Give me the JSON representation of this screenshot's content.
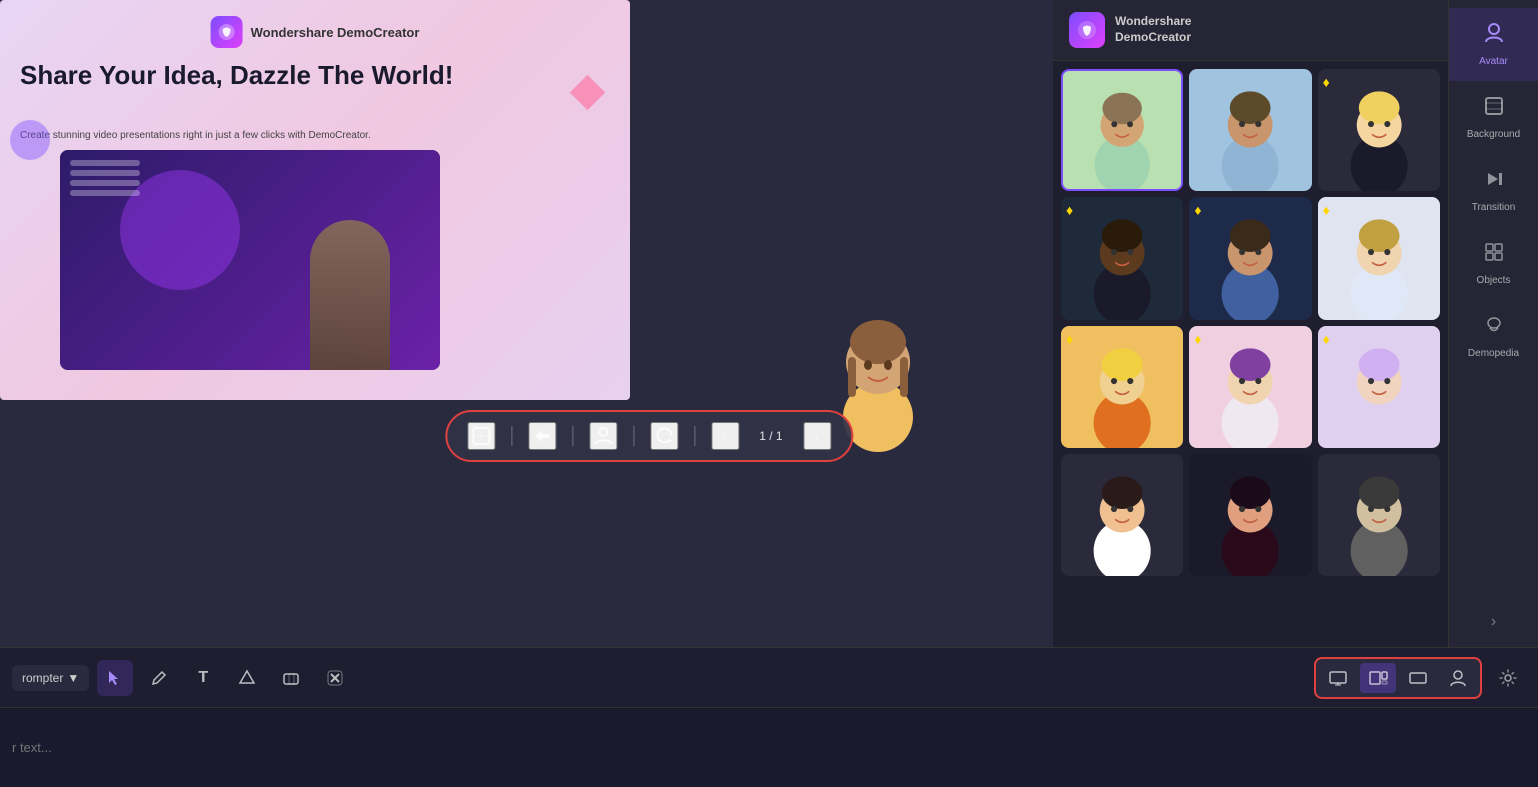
{
  "app": {
    "title": "Wondershare DemoCreator"
  },
  "header": {
    "logo_text": "Wondershare\nDemoCreator",
    "logo_icon": "D"
  },
  "slide": {
    "logo_text": "Wondershare DemoCreator",
    "headline": "Share Your Idea, Dazzle The World!",
    "subtext": "Create stunning video presentations right in just a few clicks with DemoCreator."
  },
  "floating_toolbar": {
    "counter": "1 / 1",
    "btn1_icon": "⊕",
    "btn2_icon": "⚡",
    "btn3_icon": "👤",
    "btn4_icon": "↺"
  },
  "avatar_panel": {
    "ws_logo": "D",
    "ws_name": "Wondershare\nDemoCreator",
    "avatars": [
      {
        "id": 1,
        "emoji": "🧑",
        "bg": "av-bg-1",
        "premium": false,
        "selected": true
      },
      {
        "id": 2,
        "emoji": "🧔",
        "bg": "av-bg-2",
        "premium": false,
        "selected": false
      },
      {
        "id": 3,
        "emoji": "👩‍💼",
        "bg": "av-bg-3",
        "premium": true,
        "selected": false
      },
      {
        "id": 4,
        "emoji": "🧑‍💼",
        "bg": "av-bg-4",
        "premium": true,
        "selected": false
      },
      {
        "id": 5,
        "emoji": "👩",
        "bg": "av-bg-5",
        "premium": true,
        "selected": false
      },
      {
        "id": 6,
        "emoji": "🧝‍♀️",
        "bg": "av-bg-6",
        "premium": true,
        "selected": false
      },
      {
        "id": 7,
        "emoji": "🧑‍🦱",
        "bg": "av-bg-7",
        "premium": true,
        "selected": false
      },
      {
        "id": 8,
        "emoji": "👩‍🦱",
        "bg": "av-bg-8",
        "premium": true,
        "selected": false
      },
      {
        "id": 9,
        "emoji": "🧝",
        "bg": "av-bg-9",
        "premium": true,
        "selected": false
      },
      {
        "id": 10,
        "emoji": "👧",
        "bg": "av-bg-10",
        "premium": false,
        "selected": false
      },
      {
        "id": 11,
        "emoji": "🧕",
        "bg": "av-bg-11",
        "premium": false,
        "selected": false
      },
      {
        "id": 12,
        "emoji": "🧓",
        "bg": "av-bg-12",
        "premium": false,
        "selected": false
      }
    ]
  },
  "right_sidebar": {
    "tabs": [
      {
        "id": "avatar",
        "label": "Avatar",
        "icon": "👤",
        "active": true
      },
      {
        "id": "background",
        "label": "Background",
        "icon": "🖼"
      },
      {
        "id": "transition",
        "label": "Transition",
        "icon": "▶▌"
      },
      {
        "id": "objects",
        "label": "Objects",
        "icon": "⊞"
      },
      {
        "id": "demopedia",
        "label": "Demopedia",
        "icon": "☁"
      }
    ]
  },
  "bottom_toolbar": {
    "prompter_label": "rompter",
    "prompter_arrow": "▼",
    "tools": [
      {
        "id": "select",
        "icon": "↖",
        "active": true
      },
      {
        "id": "pen",
        "icon": "✏"
      },
      {
        "id": "text",
        "icon": "T"
      },
      {
        "id": "shape",
        "icon": "⬡"
      },
      {
        "id": "eraser",
        "icon": "◇"
      },
      {
        "id": "delete",
        "icon": "🗑"
      }
    ],
    "view_btns": [
      {
        "id": "view1",
        "icon": "⊡"
      },
      {
        "id": "view2",
        "icon": "⊞"
      },
      {
        "id": "view3",
        "icon": "▭"
      },
      {
        "id": "view4",
        "icon": "👤"
      }
    ],
    "misc_icon": "⚙",
    "text_placeholder": "r text..."
  }
}
